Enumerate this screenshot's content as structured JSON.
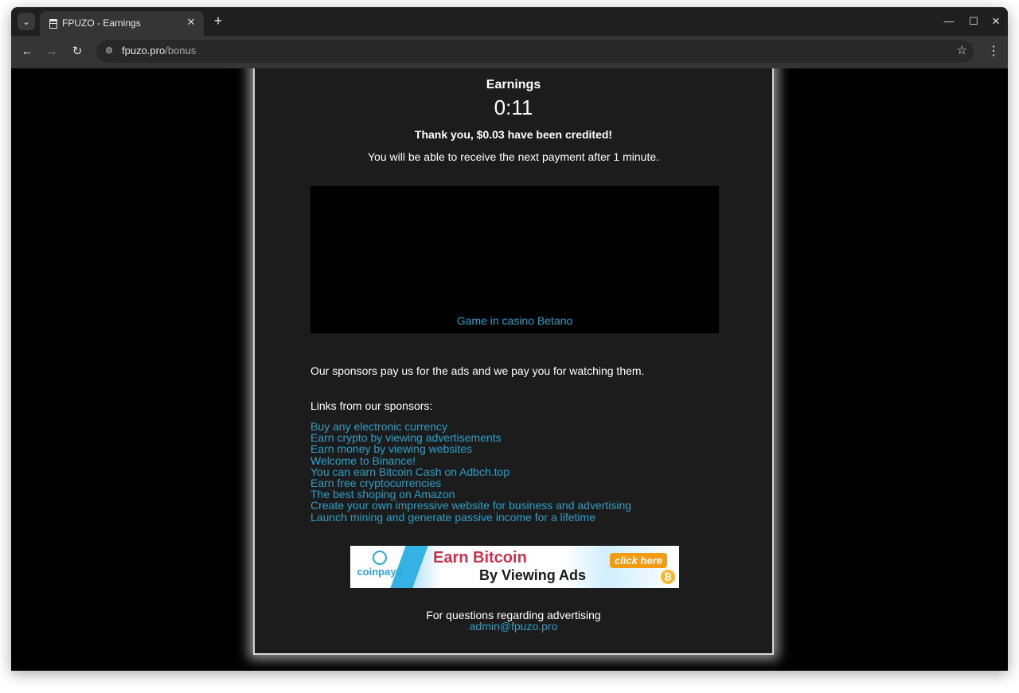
{
  "browser": {
    "tab_title": "FPUZO - Earnings",
    "tab_close": "✕",
    "new_tab": "+",
    "tab_search": "⌄",
    "window_controls": {
      "minimize": "—",
      "maximize": "☐",
      "close": "✕"
    },
    "nav": {
      "back": "←",
      "forward": "→",
      "reload": "↻"
    },
    "url_host": "fpuzo.pro",
    "url_path": "/bonus",
    "site_info_icon": "tune-icon",
    "bookmark": "☆",
    "menu": "⋮"
  },
  "page": {
    "title": "Earnings",
    "timer": "0:11",
    "credited": "Thank you, $0.03 have been credited!",
    "next_payment": "You will be able to receive the next payment after 1 minute.",
    "video_link": "Game in casino Betano",
    "sponsor_text": "Our sponsors pay us for the ads and we pay you for watching them.",
    "links_heading": "Links from our sponsors:",
    "links": [
      "Buy any electronic currency",
      "Earn crypto by viewing advertisements",
      "Earn money by viewing websites",
      "Welcome to Binance!",
      "You can earn Bitcoin Cash on Adbch.top",
      "Earn free cryptocurrencies",
      "The best shoping on Amazon",
      "Create your own impressive website for business and advertising",
      "Launch mining and generate passive income for a lifetime"
    ],
    "banner": {
      "logo_text": "coinpayu",
      "line1": "Earn Bitcoin",
      "line2": "By Viewing Ads",
      "cta": "click here",
      "coin": "₿"
    },
    "footer_text": "For questions regarding advertising",
    "footer_email": "admin@fpuzo.pro"
  },
  "colors": {
    "link": "#2aa0c9",
    "content_bg": "#1c1c1c",
    "page_bg": "#000000"
  }
}
